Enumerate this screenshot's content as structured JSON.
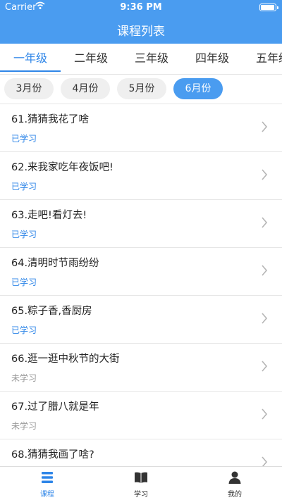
{
  "status_bar": {
    "carrier": "Carrier",
    "time": "9:36 PM",
    "battery_level": 0.95
  },
  "header": {
    "title": "课程列表"
  },
  "grades": [
    {
      "label": "一年级",
      "active": true
    },
    {
      "label": "二年级",
      "active": false
    },
    {
      "label": "三年级",
      "active": false
    },
    {
      "label": "四年级",
      "active": false
    },
    {
      "label": "五年级",
      "active": false
    }
  ],
  "months": [
    {
      "label": "3月份",
      "active": false
    },
    {
      "label": "4月份",
      "active": false
    },
    {
      "label": "5月份",
      "active": false
    },
    {
      "label": "6月份",
      "active": true
    }
  ],
  "lessons": [
    {
      "title": "61.猜猜我花了啥",
      "status": "已学习",
      "done": true
    },
    {
      "title": "62.来我家吃年夜饭吧!",
      "status": "已学习",
      "done": true
    },
    {
      "title": "63.走吧!看灯去!",
      "status": "已学习",
      "done": true
    },
    {
      "title": "64.清明时节雨纷纷",
      "status": "已学习",
      "done": true
    },
    {
      "title": "65.粽子香,香厨房",
      "status": "已学习",
      "done": true
    },
    {
      "title": "66.逛一逛中秋节的大街",
      "status": "未学习",
      "done": false
    },
    {
      "title": "67.过了腊八就是年",
      "status": "未学习",
      "done": false
    },
    {
      "title": "68.猜猜我画了啥?",
      "status": "",
      "done": false
    }
  ],
  "tabs": [
    {
      "label": "课程",
      "icon": "list-icon",
      "active": true
    },
    {
      "label": "学习",
      "icon": "book-icon",
      "active": false
    },
    {
      "label": "我的",
      "icon": "person-icon",
      "active": false
    }
  ],
  "colors": {
    "primary": "#4a9cf0",
    "accent": "#2f86e8",
    "muted": "#999999"
  }
}
